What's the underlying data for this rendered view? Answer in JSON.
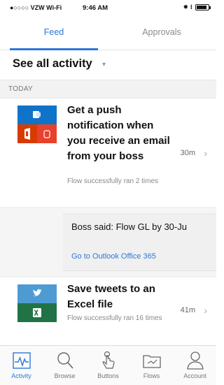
{
  "status_bar": {
    "carrier": "●○○○○ VZW Wi-Fi",
    "time": "9:46 AM",
    "right_indicators": "✹ ⁝"
  },
  "tabs": [
    {
      "label": "Feed",
      "active": true
    },
    {
      "label": "Approvals",
      "active": false
    }
  ],
  "activity": {
    "title": "See all activity",
    "caret": "▾"
  },
  "section": {
    "label": "TODAY"
  },
  "cards": [
    {
      "title": "Get a push notification when you receive an email from your boss",
      "subtitle": "Flow successfully ran 2 times",
      "time": "30m",
      "chevron": "›",
      "icons": [
        "outlook-icon",
        "office-icon",
        "notification-icon"
      ]
    },
    {
      "title": "Save tweets to an Excel file",
      "subtitle": "Flow successfully ran 16 times",
      "time": "41m",
      "chevron": "›",
      "icons": [
        "twitter-icon",
        "excel-icon"
      ]
    }
  ],
  "notification_detail": {
    "message": "Boss said: Flow GL by 30-Ju",
    "link": "Go to Outlook Office 365"
  },
  "bottom_nav": [
    {
      "label": "Activity",
      "active": true
    },
    {
      "label": "Browse",
      "active": false
    },
    {
      "label": "Buttons",
      "active": false
    },
    {
      "label": "Flows",
      "active": false
    },
    {
      "label": "Account",
      "active": false
    }
  ],
  "colors": {
    "accent": "#2f77d6",
    "outlook_blue": "#0f73c9",
    "office_red": "#d83b01",
    "twitter_blue": "#4e9bd4",
    "excel_green": "#217346"
  }
}
